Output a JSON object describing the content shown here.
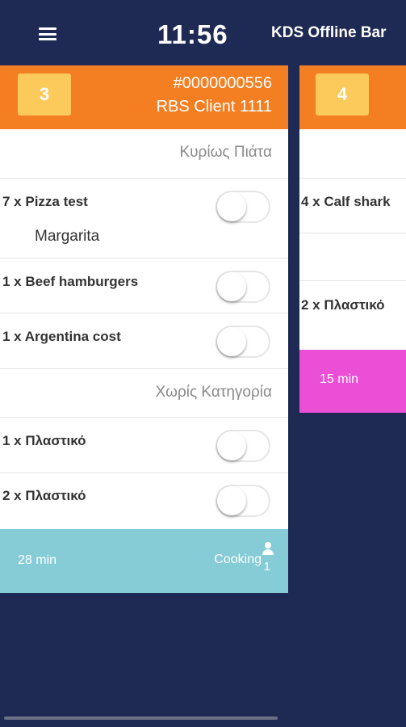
{
  "header": {
    "menu_icon": "hamburger-menu-icon",
    "time": "11:56",
    "title": "KDS Offline Bar"
  },
  "colors": {
    "background": "#1f2a54",
    "header_orange": "#f37f22",
    "badge_yellow": "#fcc95b",
    "cooking_footer": "#85ccd6",
    "late_footer": "#ea4fd6"
  },
  "tickets": [
    {
      "number": "3",
      "order_no": "#0000000556",
      "client": "RBS Client 1111",
      "categories": [
        "Κυρίως Πιάτα",
        "Χωρίς Κατηγορία"
      ],
      "items": [
        {
          "label": "7 x Pizza test",
          "modifier": "Margarita",
          "done": false
        },
        {
          "label": "1 x Beef hamburgers",
          "done": false
        },
        {
          "label": "1 x Argentina cost",
          "done": false
        },
        {
          "label": "1 x Πλαστικό",
          "done": false
        },
        {
          "label": "2 x Πλαστικό",
          "done": false
        }
      ],
      "footer": {
        "timer": "28 min",
        "status": "Cooking",
        "user_count": "1",
        "user_icon": "user-icon"
      }
    },
    {
      "number": "4",
      "items": [
        {
          "label": "4 x Calf shark"
        },
        {
          "label": "2 x Πλαστικό"
        }
      ],
      "footer": {
        "timer": "15 min"
      }
    }
  ]
}
